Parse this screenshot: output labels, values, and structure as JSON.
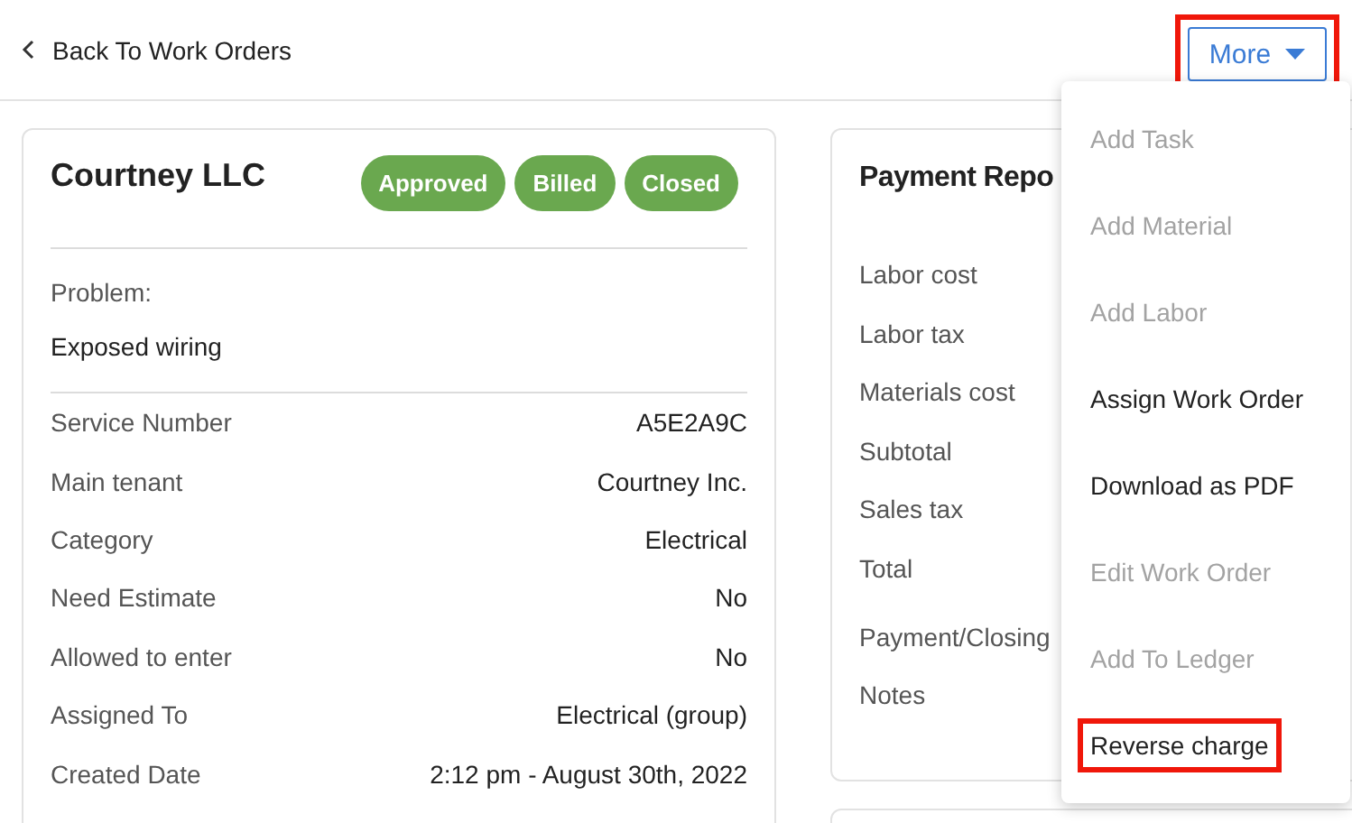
{
  "header": {
    "back_link": "Back To Work Orders",
    "more_button": {
      "label": "More",
      "highlighted": true
    }
  },
  "work_order": {
    "title": "Courtney LLC",
    "statuses": [
      "Approved",
      "Billed",
      "Closed"
    ],
    "problem_label": "Problem:",
    "problem": "Exposed wiring",
    "details": [
      {
        "label": "Service Number",
        "value": "A5E2A9C"
      },
      {
        "label": "Main tenant",
        "value": "Courtney Inc."
      },
      {
        "label": "Category",
        "value": "Electrical"
      },
      {
        "label": "Need Estimate",
        "value": "No"
      },
      {
        "label": "Allowed to enter",
        "value": "No"
      },
      {
        "label": "Assigned To",
        "value": "Electrical (group)"
      },
      {
        "label": "Created Date",
        "value": "2:12 pm - August 30th, 2022"
      }
    ]
  },
  "payment_report": {
    "title": "Payment Repo",
    "labels": [
      "Labor cost",
      "Labor tax",
      "Materials cost",
      "Subtotal",
      "Sales tax",
      "Total",
      "Payment/Closing Notes"
    ]
  },
  "more_menu": [
    {
      "label": "Add Task",
      "disabled": true,
      "highlighted": false
    },
    {
      "label": "Add Material",
      "disabled": true,
      "highlighted": false
    },
    {
      "label": "Add Labor",
      "disabled": true,
      "highlighted": false
    },
    {
      "label": "Assign Work Order",
      "disabled": false,
      "highlighted": false
    },
    {
      "label": "Download as PDF",
      "disabled": false,
      "highlighted": false
    },
    {
      "label": "Edit Work Order",
      "disabled": true,
      "highlighted": false
    },
    {
      "label": "Add To Ledger",
      "disabled": true,
      "highlighted": false
    },
    {
      "label": "Reverse charge",
      "disabled": false,
      "highlighted": true
    }
  ]
}
